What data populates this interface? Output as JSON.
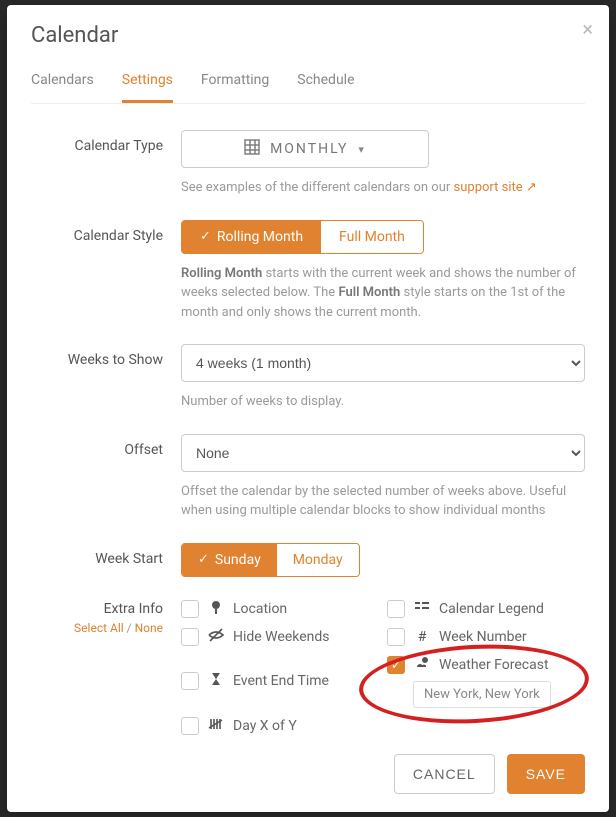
{
  "modal": {
    "title": "Calendar"
  },
  "tabs": [
    {
      "label": "Calendars"
    },
    {
      "label": "Settings"
    },
    {
      "label": "Formatting"
    },
    {
      "label": "Schedule"
    }
  ],
  "rows": {
    "calendar_type": {
      "label": "Calendar Type",
      "value": "MONTHLY",
      "help_prefix": "See examples of the different calendars on our ",
      "help_link": "support site"
    },
    "calendar_style": {
      "label": "Calendar Style",
      "option_a": "Rolling Month",
      "option_b": "Full Month",
      "desc_1a": "Rolling Month",
      "desc_1b": " starts with the current week and shows the number of weeks selected below. The ",
      "desc_1c": "Full Month",
      "desc_1d": " style starts on the 1st of the month and only shows the current month."
    },
    "weeks": {
      "label": "Weeks to Show",
      "value": "4 weeks (1 month)",
      "help": "Number of weeks to display."
    },
    "offset": {
      "label": "Offset",
      "value": "None",
      "help": "Offset the calendar by the selected number of weeks above. Useful when using multiple calendar blocks to show individual months"
    },
    "week_start": {
      "label": "Week Start",
      "option_a": "Sunday",
      "option_b": "Monday"
    },
    "extra": {
      "label": "Extra Info",
      "select_all": "Select All",
      "none": "None",
      "items": {
        "location": "Location",
        "hide_weekends": "Hide Weekends",
        "event_end_time": "Event End Time",
        "day_x_of_y": "Day X of Y",
        "calendar_legend": "Calendar Legend",
        "week_number": "Week Number",
        "weather_forecast": "Weather Forecast",
        "weather_city": "New York, New York"
      }
    }
  },
  "footer": {
    "cancel": "CANCEL",
    "save": "SAVE"
  }
}
